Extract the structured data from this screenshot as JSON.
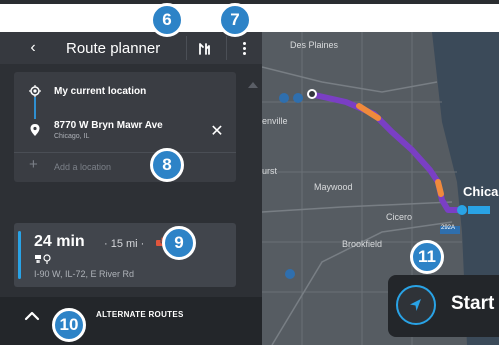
{
  "header": {
    "title": "Route planner"
  },
  "stops": [
    {
      "title": "My current location",
      "subtitle": ""
    },
    {
      "title": "8770 W Bryn Mawr Ave",
      "subtitle": "Chicago, IL"
    }
  ],
  "add_location_label": "Add a location",
  "route": {
    "time": "24 min",
    "meta": "· 15 mi ·",
    "roads": "I-90 W, IL-72, E River Rd"
  },
  "footer": {
    "label": "ALTERNATE ROUTES"
  },
  "start_label": "Start",
  "map_labels": {
    "des_plaines": "Des Plaines",
    "maywood": "Maywood",
    "cicero": "Cicero",
    "brookfield": "Brookfield",
    "chicago": "Chica",
    "rosemont_partial": "enville",
    "hurst_partial": "urst",
    "route_shield": "292A"
  },
  "callouts": [
    "6",
    "7",
    "8",
    "9",
    "10",
    "11"
  ],
  "colors": {
    "accent": "#29a3e6",
    "route": "#7a3fc4",
    "traffic": "#f08a3c",
    "callout": "#2d83c7"
  }
}
